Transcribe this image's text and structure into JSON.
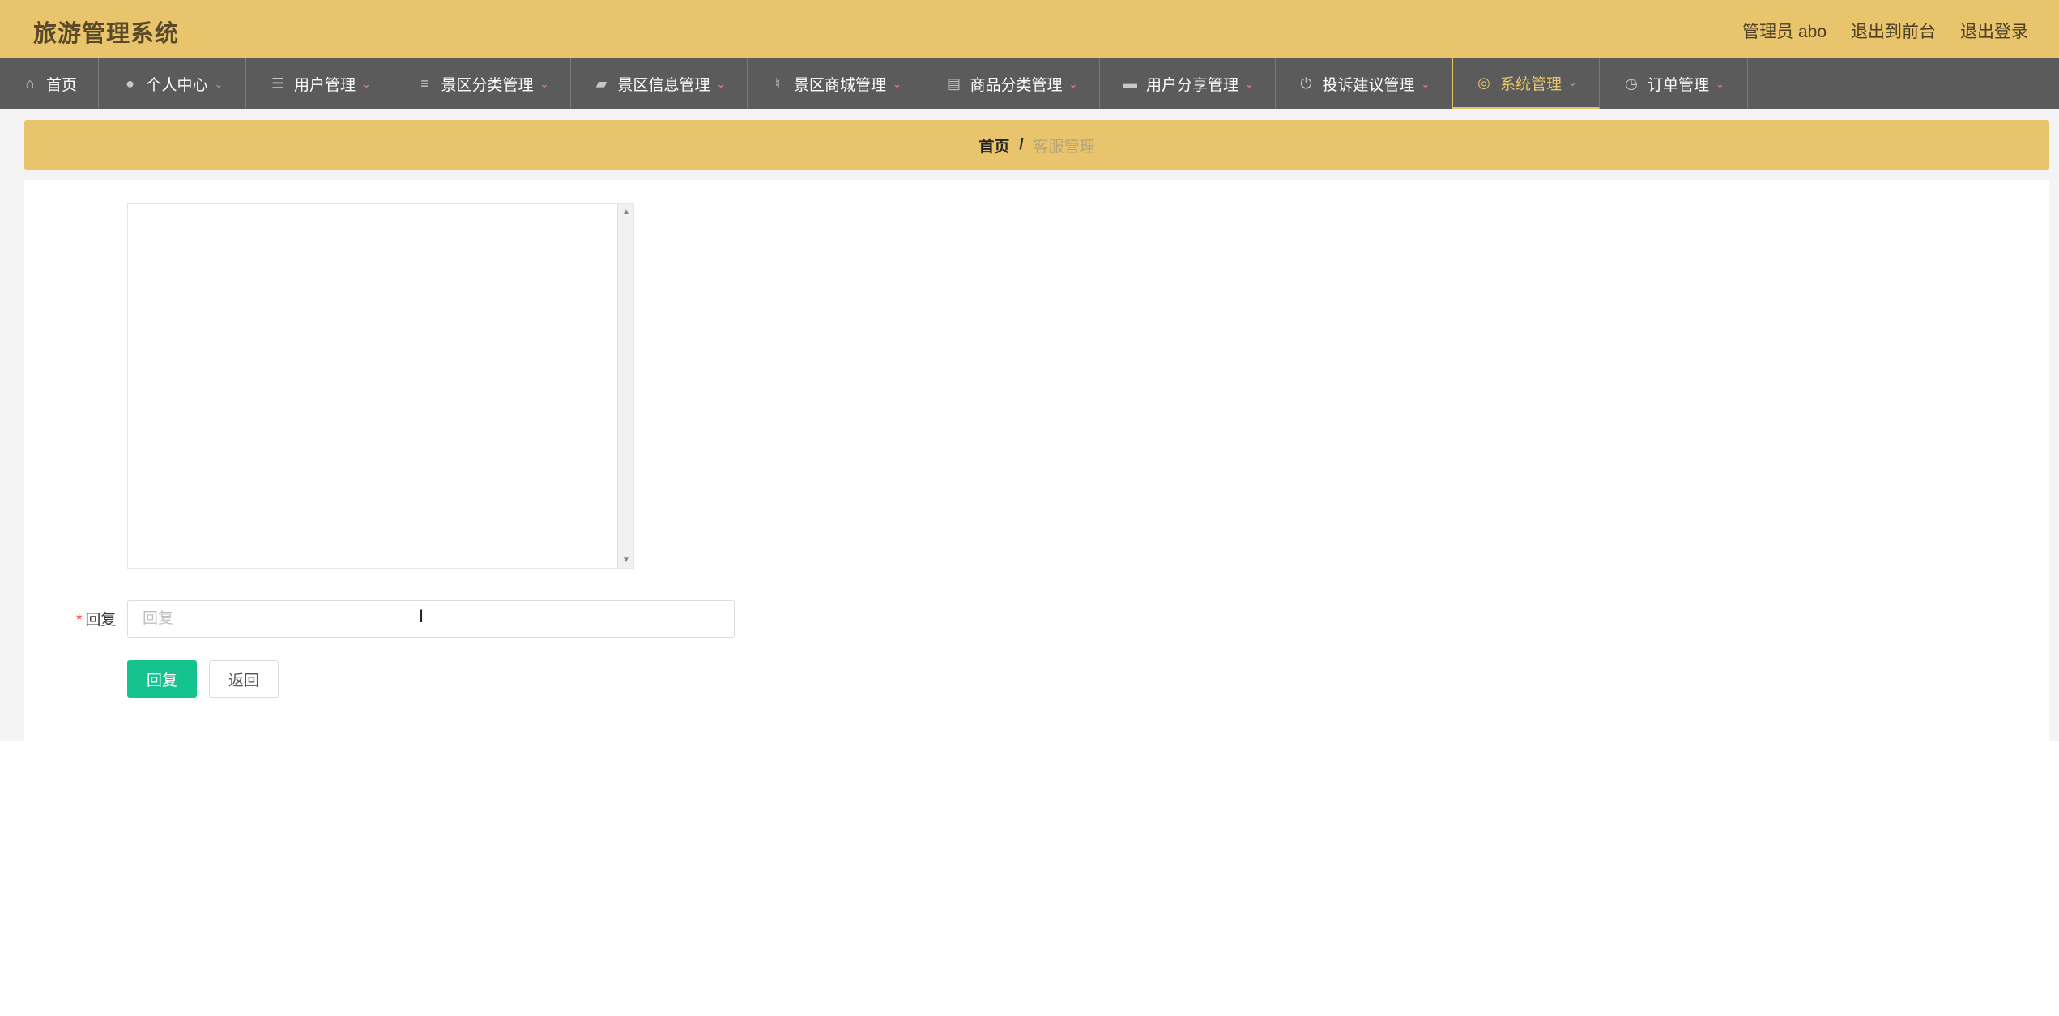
{
  "header": {
    "title": "旅游管理系统",
    "user_label": "管理员 abo",
    "to_frontend": "退出到前台",
    "logout": "退出登录"
  },
  "nav": {
    "items": [
      {
        "label": "首页",
        "icon": "home-icon",
        "caret": false,
        "active": false
      },
      {
        "label": "个人中心",
        "icon": "user-icon",
        "caret": true,
        "active": false
      },
      {
        "label": "用户管理",
        "icon": "list-icon",
        "caret": true,
        "active": false
      },
      {
        "label": "景区分类管理",
        "icon": "sliders-icon",
        "caret": true,
        "active": false
      },
      {
        "label": "景区信息管理",
        "icon": "wallet-icon",
        "caret": true,
        "active": false
      },
      {
        "label": "景区商城管理",
        "icon": "microphone-icon",
        "caret": true,
        "active": false
      },
      {
        "label": "商品分类管理",
        "icon": "clipboard-icon",
        "caret": true,
        "active": false
      },
      {
        "label": "用户分享管理",
        "icon": "briefcase-icon",
        "caret": true,
        "active": false
      },
      {
        "label": "投诉建议管理",
        "icon": "power-icon",
        "caret": true,
        "active": false
      },
      {
        "label": "系统管理",
        "icon": "compass-icon",
        "caret": true,
        "active": true
      },
      {
        "label": "订单管理",
        "icon": "clock-icon",
        "caret": true,
        "active": false
      }
    ]
  },
  "breadcrumb": {
    "home": "首页",
    "separator": "/",
    "current": "客服管理"
  },
  "form": {
    "reply_label": "回复",
    "reply_placeholder": "回复",
    "reply_value": "",
    "submit_label": "回复",
    "back_label": "返回"
  },
  "colors": {
    "accent": "#e8c46c",
    "nav_bg": "#5b5b5b",
    "primary_button": "#14c38e",
    "caret": "#f08080"
  }
}
